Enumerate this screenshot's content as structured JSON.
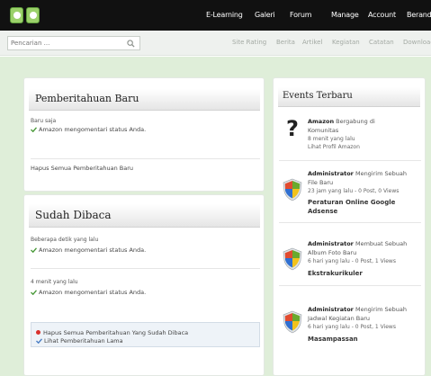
{
  "nav": {
    "items": [
      "E-Learning",
      "Galeri",
      "Forum",
      "Manage",
      "Account",
      "Beranda"
    ]
  },
  "search": {
    "placeholder": "Pencarian ..."
  },
  "subnav": {
    "items": [
      "Site Rating",
      "Berita",
      "Artikel",
      "Kegiatan",
      "Catatan",
      "Download"
    ]
  },
  "new_notifications": {
    "title": "Pemberitahuan Baru",
    "items": [
      {
        "time": "Baru saja",
        "text": "Amazon mengomentari status Anda."
      }
    ],
    "clear_link": "Hapus Semua Pemberitahuan Baru"
  },
  "read_notifications": {
    "title": "Sudah Dibaca",
    "items": [
      {
        "time": "Beberapa detik yang lalu",
        "text": "Amazon mengomentari status Anda."
      },
      {
        "time": "4 menit yang lalu",
        "text": "Amazon mengomentari status Anda."
      }
    ],
    "delete_link": "Hapus Semua Pemberitahuan Yang Sudah Dibaca",
    "old_link": "Lihat Pemberitahuan Lama"
  },
  "events": {
    "title": "Events Terbaru",
    "items": [
      {
        "icon": "question-mark-icon",
        "actor": "Amazon",
        "action_line1": " Bergabung di",
        "action_line2": "Komunitas",
        "meta": "8 menit yang lalu",
        "link": "Lihat Profil Amazon",
        "title": ""
      },
      {
        "icon": "shield-icon",
        "actor": "Administrator",
        "action_line1": " Mengirim Sebuah",
        "action_line2": "File Baru",
        "meta": "23 jam yang lalu - 0 Post, 0 Views",
        "link": "",
        "title": "Peraturan Online Google",
        "title2": "Adsense"
      },
      {
        "icon": "shield-icon",
        "actor": "Administrator",
        "action_line1": " Membuat Sebuah",
        "action_line2": "Album Foto Baru",
        "meta": "6 hari yang lalu - 0 Post, 1 Views",
        "link": "",
        "title": "Ekstrakurikuler"
      },
      {
        "icon": "shield-icon",
        "actor": "Administrator",
        "action_line1": " Mengirim Sebuah",
        "action_line2": "Jadwal Kegiatan Baru",
        "meta": "6 hari yang lalu - 0 Post, 1 Views",
        "link": "",
        "title": "Masampassan"
      }
    ]
  },
  "colors": {
    "topbar": "#111111",
    "area_bg": "#dfeed9",
    "accent_green": "#5f9e3b",
    "alert_red": "#d9302c"
  }
}
